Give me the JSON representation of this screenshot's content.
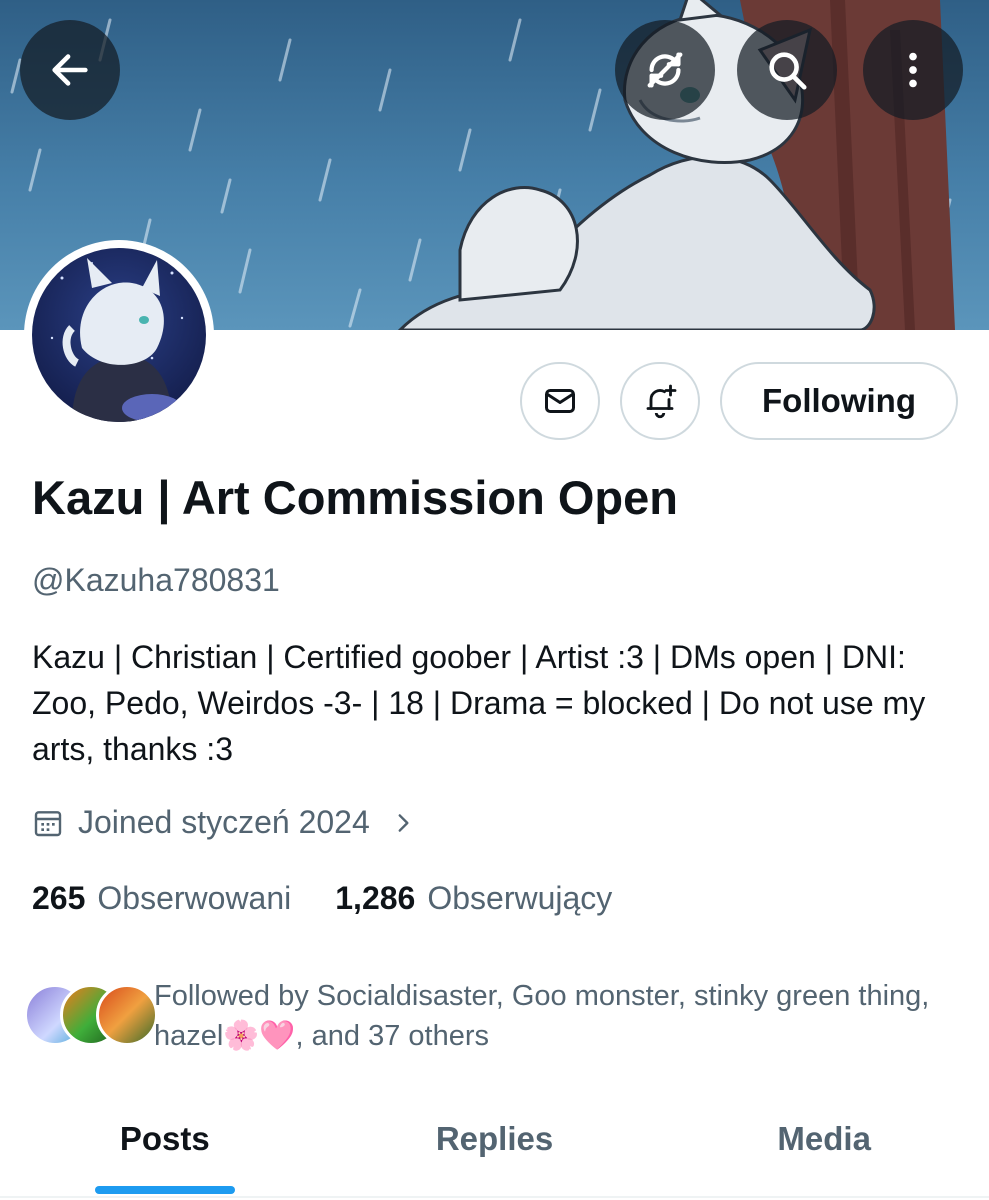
{
  "header": {
    "back_icon": "arrow-left-icon",
    "sync_icon": "sync-off-icon",
    "search_icon": "search-icon",
    "more_icon": "more-vertical-icon"
  },
  "profile": {
    "display_name": "Kazu | Art Commission Open",
    "handle": "@Kazuha780831",
    "bio": "Kazu | Christian | Certified goober | Artist :3 | DMs open | DNI: Zoo, Pedo, Weirdos -3- | 18 | Drama = blocked | Do not use my arts, thanks :3",
    "joined": "Joined styczeń 2024"
  },
  "actions": {
    "message_icon": "envelope-icon",
    "notify_icon": "bell-plus-icon",
    "following_label": "Following"
  },
  "stats": {
    "following_count": "265",
    "following_label": "Obserwowani",
    "followers_count": "1,286",
    "followers_label": "Obserwujący"
  },
  "followed_by": {
    "text": "Followed by Socialdisaster, Goo monster, stinky green thing, hazel🌸🩷, and 37 others"
  },
  "tabs": [
    {
      "label": "Posts",
      "active": true
    },
    {
      "label": "Replies",
      "active": false
    },
    {
      "label": "Media",
      "active": false
    }
  ],
  "colors": {
    "accent": "#1d9bf0",
    "text_primary": "#0f1419",
    "text_secondary": "#536471",
    "border": "#cfd9de"
  }
}
